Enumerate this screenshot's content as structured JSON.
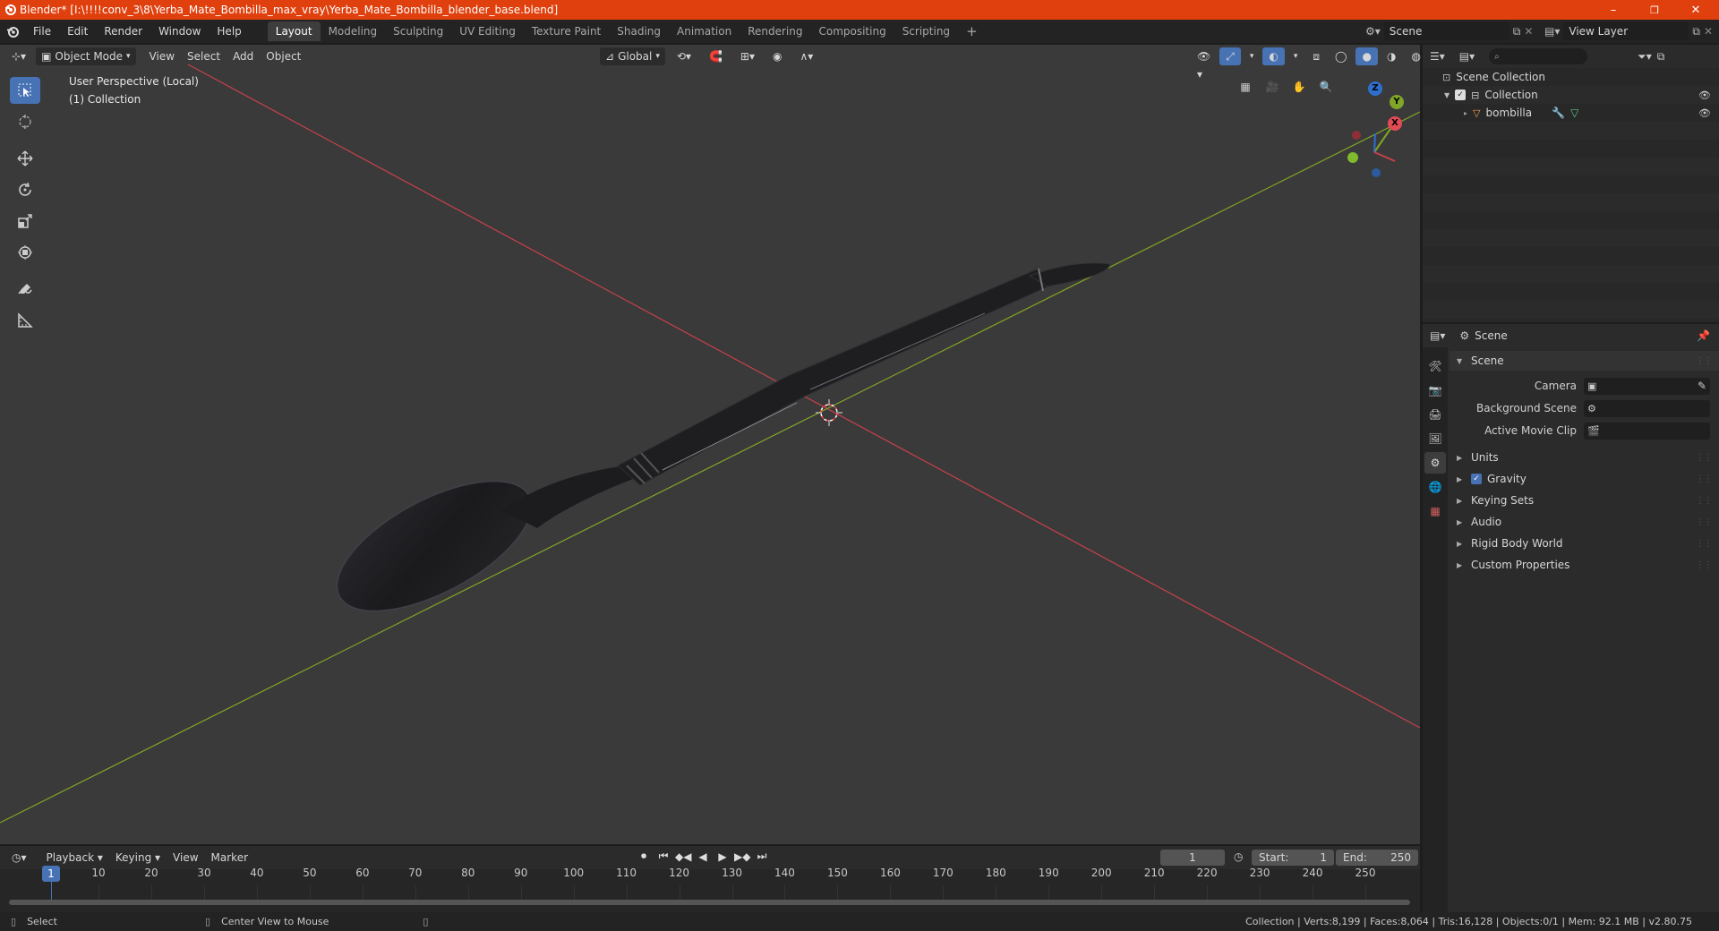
{
  "window": {
    "title": "Blender* [I:\\!!!!conv_3\\8\\Yerba_Mate_Bombilla_max_vray\\Yerba_Mate_Bombilla_blender_base.blend]",
    "controls": {
      "minimize": "–",
      "restore": "❐",
      "close": "✕"
    }
  },
  "menu": [
    "File",
    "Edit",
    "Render",
    "Window",
    "Help"
  ],
  "workspaces": [
    "Layout",
    "Modeling",
    "Sculpting",
    "UV Editing",
    "Texture Paint",
    "Shading",
    "Animation",
    "Rendering",
    "Compositing",
    "Scripting"
  ],
  "add_workspace": "+",
  "scene_selector": "Scene",
  "view_layer_selector": "View Layer",
  "viewport": {
    "mode": "Object Mode",
    "menus": [
      "View",
      "Select",
      "Add",
      "Object"
    ],
    "transform_orientation": "Global",
    "overlay_line1": "User Perspective (Local)",
    "overlay_line2": "(1) Collection",
    "gizmo": {
      "x": "X",
      "y": "Y",
      "z": "Z"
    }
  },
  "outliner": {
    "root": "Scene Collection",
    "collection": "Collection",
    "object": "bombilla"
  },
  "properties": {
    "header": "Scene",
    "panel_title": "Scene",
    "fields": [
      {
        "label": "Camera",
        "value": ""
      },
      {
        "label": "Background Scene",
        "value": ""
      },
      {
        "label": "Active Movie Clip",
        "value": ""
      }
    ],
    "subpanels": [
      "Units",
      "Gravity",
      "Keying Sets",
      "Audio",
      "Rigid Body World",
      "Custom Properties"
    ],
    "gravity_checked": true
  },
  "timeline": {
    "menus": [
      "Playback",
      "Keying",
      "View",
      "Marker"
    ],
    "current_frame": "1",
    "start_label": "Start:",
    "start_value": "1",
    "end_label": "End:",
    "end_value": "250",
    "ticks": [
      "1",
      "10",
      "20",
      "30",
      "40",
      "50",
      "60",
      "70",
      "80",
      "90",
      "100",
      "110",
      "120",
      "130",
      "140",
      "150",
      "160",
      "170",
      "180",
      "190",
      "200",
      "210",
      "220",
      "230",
      "240",
      "250"
    ]
  },
  "statusbar": {
    "select": "Select",
    "center": "Center View to Mouse",
    "stats": "Collection | Verts:8,199 | Faces:8,064 | Tris:16,128 | Objects:0/1 | Mem: 92.1 MB | v2.80.75"
  },
  "colors": {
    "titlebar": "#e0400e",
    "accent": "#4772b3",
    "x_axis": "#c8414b",
    "y_axis": "#7fa626"
  }
}
